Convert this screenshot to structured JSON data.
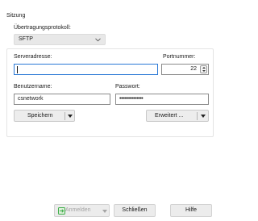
{
  "session": {
    "title": "Sitzung",
    "protocol_label": "Übertragungsprotokoll:",
    "protocol_value": "SFTP",
    "server_label": "Serveradresse:",
    "server_value": "",
    "port_label": "Portnummer:",
    "port_value": "22",
    "user_label": "Benutzername:",
    "user_value": "csnetwork",
    "password_label": "Passwort:",
    "password_mask": "•••••••••••••••"
  },
  "buttons": {
    "save": "Speichern",
    "advanced": "Erweitert ...",
    "login": "Anmelden",
    "close": "Schließen",
    "help": "Hilfe"
  },
  "colors": {
    "focus_border": "#2b79d6",
    "login_icon": "#3fae49"
  },
  "icons": {
    "login": "login-icon",
    "protocol_dropdown": "chevron-down-icon"
  }
}
